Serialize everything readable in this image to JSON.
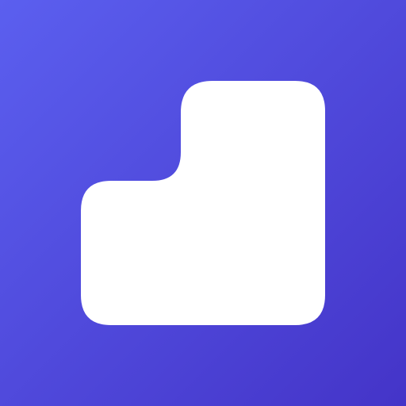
{
  "icon": {
    "name": "app-logo-icon",
    "colors": {
      "gradient_start": "#5B5FEF",
      "gradient_end": "#4434C8",
      "glyph": "#FFFFFF"
    }
  }
}
